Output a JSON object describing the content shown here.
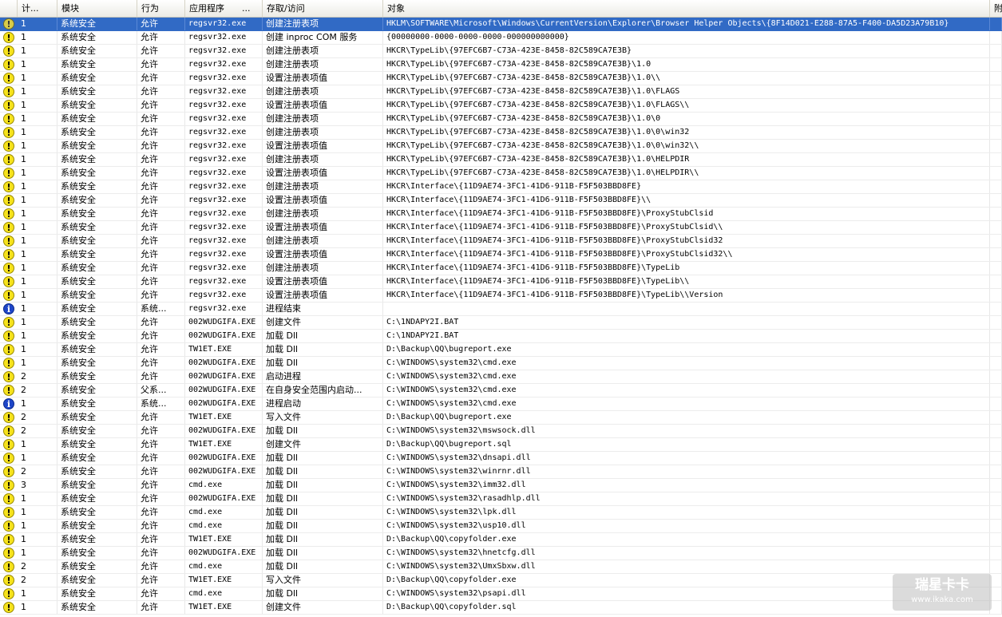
{
  "columns": [
    "计...",
    "模块",
    "行为",
    "应用程序",
    "...",
    "存取/访问",
    "对象",
    "附"
  ],
  "rows": [
    {
      "icon": "warning",
      "count": "1",
      "module": "系统安全",
      "action": "允许",
      "app": "regsvr32.exe",
      "access": "创建注册表项",
      "object": "HKLM\\SOFTWARE\\Microsoft\\Windows\\CurrentVersion\\Explorer\\Browser Helper Objects\\{8F14D021-E288-87A5-F400-DA5D23A79B10}",
      "selected": true
    },
    {
      "icon": "warning",
      "count": "1",
      "module": "系统安全",
      "action": "允许",
      "app": "regsvr32.exe",
      "access": "创建 inproc COM 服务",
      "object": "{00000000-0000-0000-0000-000000000000}"
    },
    {
      "icon": "warning",
      "count": "1",
      "module": "系统安全",
      "action": "允许",
      "app": "regsvr32.exe",
      "access": "创建注册表项",
      "object": "HKCR\\TypeLib\\{97EFC6B7-C73A-423E-8458-82C589CA7E3B}"
    },
    {
      "icon": "warning",
      "count": "1",
      "module": "系统安全",
      "action": "允许",
      "app": "regsvr32.exe",
      "access": "创建注册表项",
      "object": "HKCR\\TypeLib\\{97EFC6B7-C73A-423E-8458-82C589CA7E3B}\\1.0"
    },
    {
      "icon": "warning",
      "count": "1",
      "module": "系统安全",
      "action": "允许",
      "app": "regsvr32.exe",
      "access": "设置注册表项值",
      "object": "HKCR\\TypeLib\\{97EFC6B7-C73A-423E-8458-82C589CA7E3B}\\1.0\\\\"
    },
    {
      "icon": "warning",
      "count": "1",
      "module": "系统安全",
      "action": "允许",
      "app": "regsvr32.exe",
      "access": "创建注册表项",
      "object": "HKCR\\TypeLib\\{97EFC6B7-C73A-423E-8458-82C589CA7E3B}\\1.0\\FLAGS"
    },
    {
      "icon": "warning",
      "count": "1",
      "module": "系统安全",
      "action": "允许",
      "app": "regsvr32.exe",
      "access": "设置注册表项值",
      "object": "HKCR\\TypeLib\\{97EFC6B7-C73A-423E-8458-82C589CA7E3B}\\1.0\\FLAGS\\\\"
    },
    {
      "icon": "warning",
      "count": "1",
      "module": "系统安全",
      "action": "允许",
      "app": "regsvr32.exe",
      "access": "创建注册表项",
      "object": "HKCR\\TypeLib\\{97EFC6B7-C73A-423E-8458-82C589CA7E3B}\\1.0\\0"
    },
    {
      "icon": "warning",
      "count": "1",
      "module": "系统安全",
      "action": "允许",
      "app": "regsvr32.exe",
      "access": "创建注册表项",
      "object": "HKCR\\TypeLib\\{97EFC6B7-C73A-423E-8458-82C589CA7E3B}\\1.0\\0\\win32"
    },
    {
      "icon": "warning",
      "count": "1",
      "module": "系统安全",
      "action": "允许",
      "app": "regsvr32.exe",
      "access": "设置注册表项值",
      "object": "HKCR\\TypeLib\\{97EFC6B7-C73A-423E-8458-82C589CA7E3B}\\1.0\\0\\win32\\\\"
    },
    {
      "icon": "warning",
      "count": "1",
      "module": "系统安全",
      "action": "允许",
      "app": "regsvr32.exe",
      "access": "创建注册表项",
      "object": "HKCR\\TypeLib\\{97EFC6B7-C73A-423E-8458-82C589CA7E3B}\\1.0\\HELPDIR"
    },
    {
      "icon": "warning",
      "count": "1",
      "module": "系统安全",
      "action": "允许",
      "app": "regsvr32.exe",
      "access": "设置注册表项值",
      "object": "HKCR\\TypeLib\\{97EFC6B7-C73A-423E-8458-82C589CA7E3B}\\1.0\\HELPDIR\\\\"
    },
    {
      "icon": "warning",
      "count": "1",
      "module": "系统安全",
      "action": "允许",
      "app": "regsvr32.exe",
      "access": "创建注册表项",
      "object": "HKCR\\Interface\\{11D9AE74-3FC1-41D6-911B-F5F503BBD8FE}"
    },
    {
      "icon": "warning",
      "count": "1",
      "module": "系统安全",
      "action": "允许",
      "app": "regsvr32.exe",
      "access": "设置注册表项值",
      "object": "HKCR\\Interface\\{11D9AE74-3FC1-41D6-911B-F5F503BBD8FE}\\\\"
    },
    {
      "icon": "warning",
      "count": "1",
      "module": "系统安全",
      "action": "允许",
      "app": "regsvr32.exe",
      "access": "创建注册表项",
      "object": "HKCR\\Interface\\{11D9AE74-3FC1-41D6-911B-F5F503BBD8FE}\\ProxyStubClsid"
    },
    {
      "icon": "warning",
      "count": "1",
      "module": "系统安全",
      "action": "允许",
      "app": "regsvr32.exe",
      "access": "设置注册表项值",
      "object": "HKCR\\Interface\\{11D9AE74-3FC1-41D6-911B-F5F503BBD8FE}\\ProxyStubClsid\\\\"
    },
    {
      "icon": "warning",
      "count": "1",
      "module": "系统安全",
      "action": "允许",
      "app": "regsvr32.exe",
      "access": "创建注册表项",
      "object": "HKCR\\Interface\\{11D9AE74-3FC1-41D6-911B-F5F503BBD8FE}\\ProxyStubClsid32"
    },
    {
      "icon": "warning",
      "count": "1",
      "module": "系统安全",
      "action": "允许",
      "app": "regsvr32.exe",
      "access": "设置注册表项值",
      "object": "HKCR\\Interface\\{11D9AE74-3FC1-41D6-911B-F5F503BBD8FE}\\ProxyStubClsid32\\\\"
    },
    {
      "icon": "warning",
      "count": "1",
      "module": "系统安全",
      "action": "允许",
      "app": "regsvr32.exe",
      "access": "创建注册表项",
      "object": "HKCR\\Interface\\{11D9AE74-3FC1-41D6-911B-F5F503BBD8FE}\\TypeLib"
    },
    {
      "icon": "warning",
      "count": "1",
      "module": "系统安全",
      "action": "允许",
      "app": "regsvr32.exe",
      "access": "设置注册表项值",
      "object": "HKCR\\Interface\\{11D9AE74-3FC1-41D6-911B-F5F503BBD8FE}\\TypeLib\\\\"
    },
    {
      "icon": "warning",
      "count": "1",
      "module": "系统安全",
      "action": "允许",
      "app": "regsvr32.exe",
      "access": "设置注册表项值",
      "object": "HKCR\\Interface\\{11D9AE74-3FC1-41D6-911B-F5F503BBD8FE}\\TypeLib\\\\Version"
    },
    {
      "icon": "info",
      "count": "1",
      "module": "系统安全",
      "action": "系统...",
      "app": "regsvr32.exe",
      "access": "进程结束",
      "object": ""
    },
    {
      "icon": "warning",
      "count": "1",
      "module": "系统安全",
      "action": "允许",
      "app": "002WUDGIFA.EXE",
      "access": "创建文件",
      "object": "C:\\1NDAPY2I.BAT"
    },
    {
      "icon": "warning",
      "count": "1",
      "module": "系统安全",
      "action": "允许",
      "app": "002WUDGIFA.EXE",
      "access": "加载 Dll",
      "object": "C:\\1NDAPY2I.BAT"
    },
    {
      "icon": "warning",
      "count": "1",
      "module": "系统安全",
      "action": "允许",
      "app": "TW1ET.EXE",
      "access": "加载 Dll",
      "object": "D:\\Backup\\QQ\\bugreport.exe"
    },
    {
      "icon": "warning",
      "count": "1",
      "module": "系统安全",
      "action": "允许",
      "app": "002WUDGIFA.EXE",
      "access": "加载 Dll",
      "object": "C:\\WINDOWS\\system32\\cmd.exe"
    },
    {
      "icon": "warning",
      "count": "2",
      "module": "系统安全",
      "action": "允许",
      "app": "002WUDGIFA.EXE",
      "access": "启动进程",
      "object": "C:\\WINDOWS\\system32\\cmd.exe"
    },
    {
      "icon": "warning",
      "count": "2",
      "module": "系统安全",
      "action": "父系...",
      "app": "002WUDGIFA.EXE",
      "access": "在自身安全范围内启动...",
      "object": "C:\\WINDOWS\\system32\\cmd.exe"
    },
    {
      "icon": "info",
      "count": "1",
      "module": "系统安全",
      "action": "系统...",
      "app": "002WUDGIFA.EXE",
      "access": "进程启动",
      "object": "C:\\WINDOWS\\system32\\cmd.exe"
    },
    {
      "icon": "warning",
      "count": "2",
      "module": "系统安全",
      "action": "允许",
      "app": "TW1ET.EXE",
      "access": "写入文件",
      "object": "D:\\Backup\\QQ\\bugreport.exe"
    },
    {
      "icon": "warning",
      "count": "2",
      "module": "系统安全",
      "action": "允许",
      "app": "002WUDGIFA.EXE",
      "access": "加载 Dll",
      "object": "C:\\WINDOWS\\system32\\mswsock.dll"
    },
    {
      "icon": "warning",
      "count": "1",
      "module": "系统安全",
      "action": "允许",
      "app": "TW1ET.EXE",
      "access": "创建文件",
      "object": "D:\\Backup\\QQ\\bugreport.sql"
    },
    {
      "icon": "warning",
      "count": "1",
      "module": "系统安全",
      "action": "允许",
      "app": "002WUDGIFA.EXE",
      "access": "加载 Dll",
      "object": "C:\\WINDOWS\\system32\\dnsapi.dll"
    },
    {
      "icon": "warning",
      "count": "2",
      "module": "系统安全",
      "action": "允许",
      "app": "002WUDGIFA.EXE",
      "access": "加载 Dll",
      "object": "C:\\WINDOWS\\system32\\winrnr.dll"
    },
    {
      "icon": "warning",
      "count": "3",
      "module": "系统安全",
      "action": "允许",
      "app": "cmd.exe",
      "access": "加载 Dll",
      "object": "C:\\WINDOWS\\system32\\imm32.dll"
    },
    {
      "icon": "warning",
      "count": "1",
      "module": "系统安全",
      "action": "允许",
      "app": "002WUDGIFA.EXE",
      "access": "加载 Dll",
      "object": "C:\\WINDOWS\\system32\\rasadhlp.dll"
    },
    {
      "icon": "warning",
      "count": "1",
      "module": "系统安全",
      "action": "允许",
      "app": "cmd.exe",
      "access": "加载 Dll",
      "object": "C:\\WINDOWS\\system32\\lpk.dll"
    },
    {
      "icon": "warning",
      "count": "1",
      "module": "系统安全",
      "action": "允许",
      "app": "cmd.exe",
      "access": "加载 Dll",
      "object": "C:\\WINDOWS\\system32\\usp10.dll"
    },
    {
      "icon": "warning",
      "count": "1",
      "module": "系统安全",
      "action": "允许",
      "app": "TW1ET.EXE",
      "access": "加载 Dll",
      "object": "D:\\Backup\\QQ\\copyfolder.exe"
    },
    {
      "icon": "warning",
      "count": "1",
      "module": "系统安全",
      "action": "允许",
      "app": "002WUDGIFA.EXE",
      "access": "加载 Dll",
      "object": "C:\\WINDOWS\\system32\\hnetcfg.dll"
    },
    {
      "icon": "warning",
      "count": "2",
      "module": "系统安全",
      "action": "允许",
      "app": "cmd.exe",
      "access": "加载 Dll",
      "object": "C:\\WINDOWS\\system32\\UmxSbxw.dll"
    },
    {
      "icon": "warning",
      "count": "2",
      "module": "系统安全",
      "action": "允许",
      "app": "TW1ET.EXE",
      "access": "写入文件",
      "object": "D:\\Backup\\QQ\\copyfolder.exe"
    },
    {
      "icon": "warning",
      "count": "1",
      "module": "系统安全",
      "action": "允许",
      "app": "cmd.exe",
      "access": "加载 Dll",
      "object": "C:\\WINDOWS\\system32\\psapi.dll"
    },
    {
      "icon": "warning",
      "count": "1",
      "module": "系统安全",
      "action": "允许",
      "app": "TW1ET.EXE",
      "access": "创建文件",
      "object": "D:\\Backup\\QQ\\copyfolder.sql"
    }
  ],
  "icons": {
    "warning": "!",
    "info": "i"
  },
  "watermark": {
    "line1": "瑞星卡卡",
    "line2": "www.ikaka.com"
  },
  "colors": {
    "selection": "#316ac5",
    "warning": "#f6e21c",
    "info": "#1e46c8"
  }
}
